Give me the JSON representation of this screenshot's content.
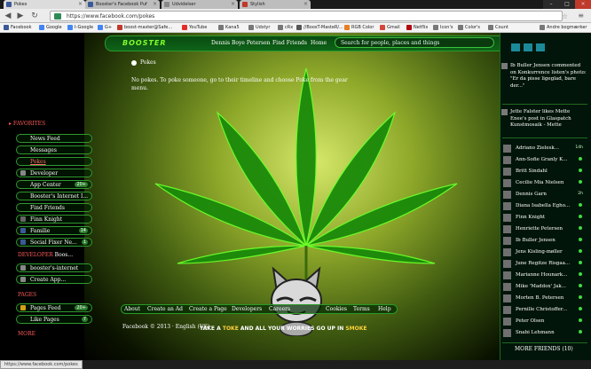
{
  "browser": {
    "tabs": [
      {
        "title": "Pokes"
      },
      {
        "title": "Booster's Facebook Puf"
      },
      {
        "title": "Udvidelser"
      },
      {
        "title": "Stylish"
      }
    ],
    "url": "https://www.facebook.com/pokes",
    "url_display": "https://www.facebook.com/pokes",
    "bookmarks": [
      "Facebook",
      "Google",
      "I-Google",
      "G+",
      "boost-master@Safe...",
      "YouTube",
      "Kana5",
      "Udstyr",
      "cRx",
      "//BoosT-MasteR/...",
      "RGB Color",
      "Gmail",
      "Netflix",
      "Icon's",
      "Color's",
      "Count",
      "Andre bogmærker"
    ],
    "status_url": "https://www.facebook.com/pokes"
  },
  "topbar": {
    "logo": "BOOSTER",
    "user_name": "Dennis Boye Petersen",
    "find_friends": "Find Friends",
    "home": "Home",
    "search_placeholder": "Search for people, places and things"
  },
  "content": {
    "title": "Pokes",
    "message": "No pokes. To poke someone, go to their timeline and choose Poke from the gear menu."
  },
  "sidebar": {
    "favorites_header": "FAVORITES",
    "favorites": [
      {
        "label": "News Feed",
        "count": ""
      },
      {
        "label": "Messages",
        "count": ""
      },
      {
        "label": "Pokes",
        "count": ""
      },
      {
        "label": "Developer",
        "count": ""
      },
      {
        "label": "App Center",
        "count": "20+"
      },
      {
        "label": "Booster's Internet I...",
        "count": ""
      },
      {
        "label": "Find Friends",
        "count": ""
      },
      {
        "label": "Finn Knight",
        "count": ""
      },
      {
        "label": "Familie",
        "count": "14"
      },
      {
        "label": "Social Fixer Ne...",
        "count": "1"
      }
    ],
    "developer_header": "DEVELOPER",
    "developer_more": "Boos...",
    "developer_items": [
      {
        "label": "booster's-internet"
      },
      {
        "label": "Create App..."
      }
    ],
    "pages_header": "PAGES",
    "pages": [
      {
        "label": "Pages Feed",
        "count": "20+"
      },
      {
        "label": "Like Pages",
        "count": "7"
      }
    ],
    "more": "MORE"
  },
  "footer": {
    "links": [
      "About",
      "Create an Ad",
      "Create a Page",
      "Developers",
      "Careers",
      "Cookies",
      "Terms",
      "Help"
    ],
    "copyright": "Facebook © 2013 · English (US)",
    "slogan_pre": "TAKE A",
    "slogan_toke": "TOKE",
    "slogan_mid": "AND ALL YOUR WORRIES GO UP IN",
    "slogan_smoke": "SMOKE"
  },
  "ticker": [
    {
      "text": "Ib Buller Jensen commented on Konkurrence listen's photo: \"Er da pisse ligeglad, bare der...\""
    },
    {
      "text": "Jette Falster likes Mette Enee's post in Glaspatch Kunstmosaik - Mette"
    }
  ],
  "friends": [
    {
      "name": "Adriano Zielesk...",
      "time": "14h"
    },
    {
      "name": "Ann-Sofie Granly K...",
      "time": ""
    },
    {
      "name": "Britt Sindahl",
      "time": ""
    },
    {
      "name": "Cecilie Mia Nielsen",
      "time": ""
    },
    {
      "name": "Dennis Garn",
      "time": "2h"
    },
    {
      "name": "Diana Isabella Egho...",
      "time": ""
    },
    {
      "name": "Finn Knight",
      "time": ""
    },
    {
      "name": "Henriette Petersen",
      "time": ""
    },
    {
      "name": "Ib Buller Jensen",
      "time": ""
    },
    {
      "name": "Jens Kisling-møller",
      "time": ""
    },
    {
      "name": "June Regitze Risgaa...",
      "time": ""
    },
    {
      "name": "Marianne Hounark...",
      "time": ""
    },
    {
      "name": "Mike 'Maddox' Jak...",
      "time": ""
    },
    {
      "name": "Morten B. Petersen",
      "time": ""
    },
    {
      "name": "Pernille Christoffer...",
      "time": ""
    },
    {
      "name": "Peter Olsen",
      "time": ""
    },
    {
      "name": "Snabi Lehmann",
      "time": ""
    }
  ],
  "more_friends": "MORE FRIENDS (10)"
}
